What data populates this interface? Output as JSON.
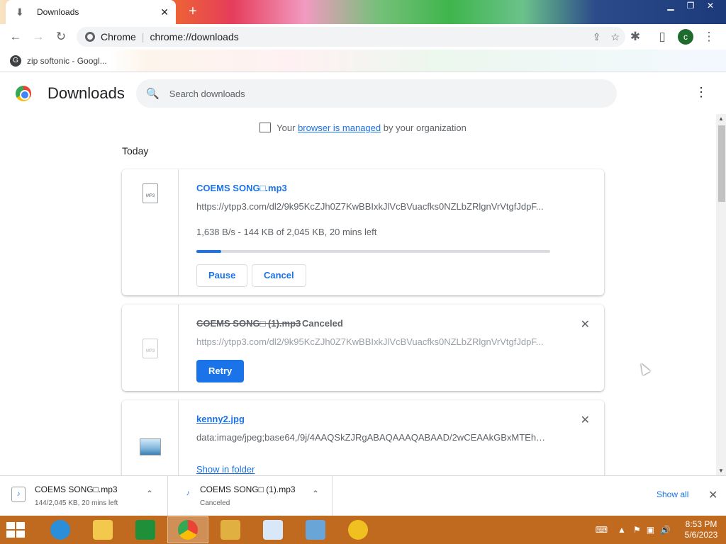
{
  "browser": {
    "tab_title": "Downloads",
    "omnibox_site": "Chrome",
    "omnibox_url": "chrome://downloads",
    "avatar_initial": "c",
    "bookmark": "zip softonic - Googl..."
  },
  "page": {
    "title": "Downloads",
    "search_placeholder": "Search downloads",
    "managed_prefix": "Your",
    "managed_link": "browser is managed",
    "managed_suffix": "by your organization",
    "section_label": "Today"
  },
  "downloads": [
    {
      "name": "COEMS SONG□.mp3",
      "url": "https://ytpp3.com/dl2/9k95KcZJh0Z7KwBBIxkJlVcBVuacfks0NZLbZRlgnVrVtgfJdpF...",
      "status": "1,638 B/s - 144 KB of 2,045 KB, 20 mins left",
      "progress": 0.07,
      "icon_text": "MP3",
      "buttons": [
        "Pause",
        "Cancel"
      ]
    },
    {
      "name": "COEMS SONG□ (1).mp3",
      "state": "Canceled",
      "url": "https://ytpp3.com/dl2/9k95KcZJh0Z7KwBBIxkJlVcBVuacfks0NZLbZRlgnVrVtgfJdpF...",
      "icon_text": "MP3",
      "button": "Retry"
    },
    {
      "name": "kenny2.jpg",
      "url": "data:image/jpeg;base64,/9j/4AAQSkZJRgABAQAAAQABAAD/2wCEAAkGBxMTEhUS...",
      "link": "Show in folder"
    }
  ],
  "shelf": {
    "items": [
      {
        "name": "COEMS SONG□.mp3",
        "status": "144/2,045 KB, 20 mins left"
      },
      {
        "name": "COEMS SONG□ (1).mp3",
        "status": "Canceled"
      }
    ],
    "show_all": "Show all"
  },
  "taskbar": {
    "time": "8:53 PM",
    "date": "5/6/2023"
  },
  "colors": {
    "accent": "#1a73e8",
    "taskbar": "#c06a1f"
  }
}
